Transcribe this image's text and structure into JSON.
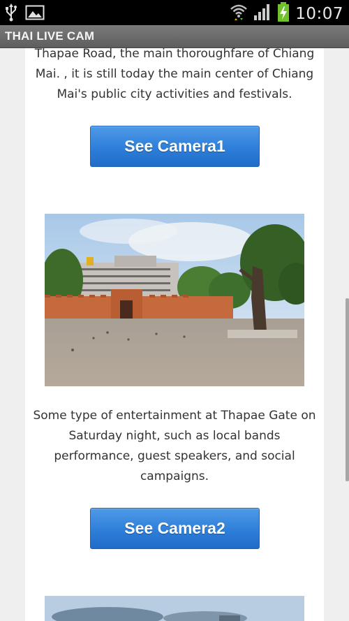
{
  "status_bar": {
    "time": "10:07",
    "icons": [
      "usb-icon",
      "gallery-icon",
      "wifi-icon",
      "signal-icon",
      "battery-charging-icon"
    ]
  },
  "app": {
    "title": "THAI LIVE CAM"
  },
  "content": {
    "items": [
      {
        "description": "Thapae Road, the main thoroughfare of Chiang Mai. , it is still today the main center of Chiang Mai's public city activities and festivals.",
        "button_label": "See Camera1"
      },
      {
        "description": "Some type of entertainment at Thapae Gate on Saturday night, such as local bands performance, guest speakers, and social campaigns.",
        "button_label": "See Camera2"
      }
    ]
  },
  "colors": {
    "button": "#2e7fd9",
    "action_bar": "#6b6b6b",
    "battery": "#6fc22b"
  }
}
